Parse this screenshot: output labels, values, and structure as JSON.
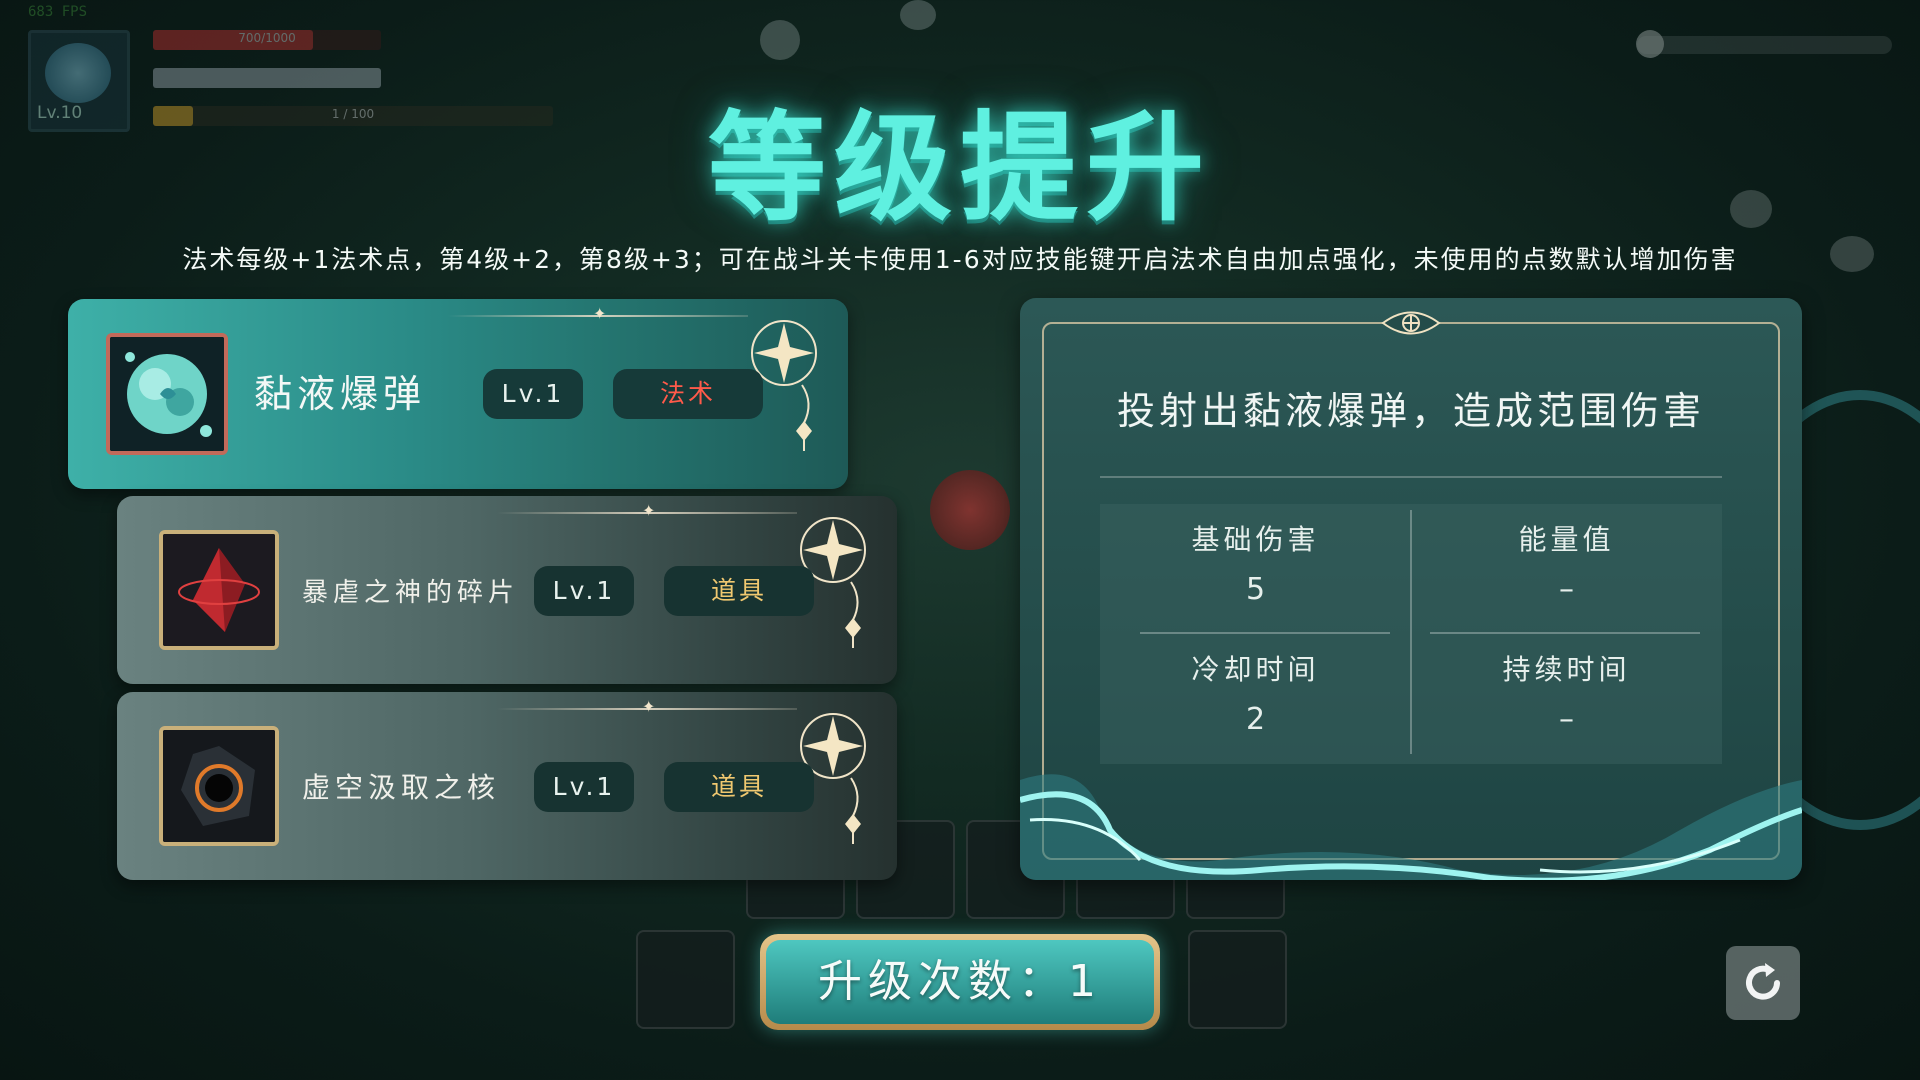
{
  "hud": {
    "fps": "683 FPS",
    "level": "Lv.10",
    "health_text": "700/1000",
    "exp_text": "1 / 100"
  },
  "title": "等级提升",
  "description": "法术每级+1法术点，第4级+2，第8级+3；可在战斗关卡使用1-6对应技能键开启法术自由加点强化，未使用的点数默认增加伤害",
  "skills": [
    {
      "name": "黏液爆弹",
      "level": "Lv.1",
      "type": "法术",
      "icon": "slime-bomb-icon",
      "selected": true
    },
    {
      "name": "暴虐之神的碎片",
      "level": "Lv.1",
      "type": "道具",
      "icon": "crimson-shard-icon",
      "selected": false
    },
    {
      "name": "虚空汲取之核",
      "level": "Lv.1",
      "type": "道具",
      "icon": "void-core-icon",
      "selected": false
    }
  ],
  "detail": {
    "description": "投射出黏液爆弹，造成范围伤害",
    "stats": [
      {
        "label": "基础伤害",
        "value": "5"
      },
      {
        "label": "能量值",
        "value": "–"
      },
      {
        "label": "冷却时间",
        "value": "2"
      },
      {
        "label": "持续时间",
        "value": "–"
      }
    ]
  },
  "upgrade_count_label": "升级次数：1",
  "colors": {
    "title": "#5ff0e0",
    "spell_type": "#ff5a4a",
    "item_type": "#f0c870",
    "frame_gold": "#e2ceaa"
  },
  "icons": [
    "refresh-icon",
    "skull-icon",
    "star-corner-icon",
    "eye-ornament-icon"
  ]
}
